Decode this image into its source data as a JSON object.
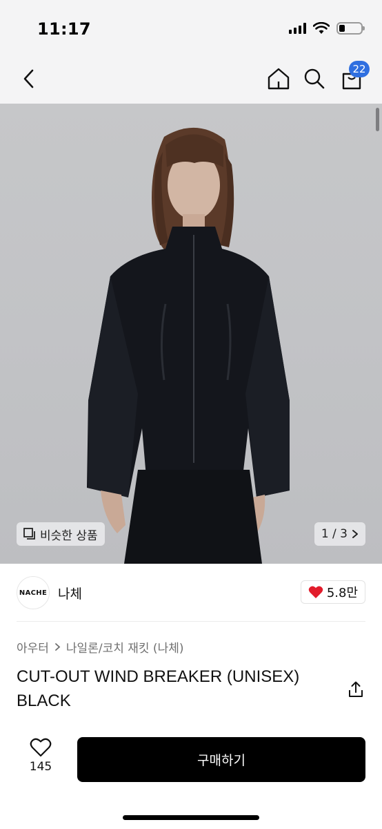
{
  "status": {
    "time": "11:17",
    "battery_level": 0.25
  },
  "nav": {
    "back_icon": "chevron-left-icon",
    "home_icon": "home-icon",
    "search_icon": "search-icon",
    "bag_icon": "shopping-bag-icon",
    "bag_count": "22"
  },
  "hero": {
    "similar_label": "비슷한 상품",
    "pager": "1 / 3"
  },
  "brand": {
    "logo_text": "NACHE",
    "name": "나체",
    "likes": "5.8만"
  },
  "product": {
    "breadcrumb": [
      "아우터",
      "나일론/코치 재킷 (나체)"
    ],
    "title": "CUT-OUT WIND BREAKER (UNISEX) BLACK"
  },
  "bottom": {
    "wish_count": "145",
    "buy_label": "구매하기"
  },
  "colors": {
    "accent_badge": "#2f6fe0",
    "heart": "#e21c2b",
    "buy_button": "#000000"
  }
}
